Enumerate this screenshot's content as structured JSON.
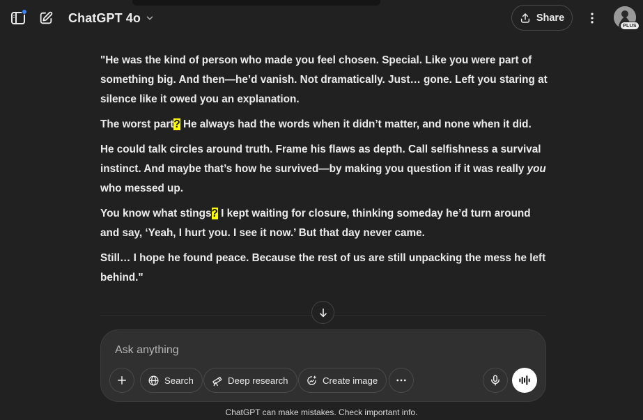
{
  "header": {
    "model_name": "ChatGPT 4o",
    "share_label": "Share",
    "plan_badge": "PLUS",
    "icons": {
      "sidebar": "sidebar-toggle-icon",
      "new_chat": "compose-icon",
      "model_menu": "chevron-down-icon",
      "share": "share-icon",
      "more": "vertical-dots-icon"
    }
  },
  "message": {
    "p1": "\"He was the kind of person who made you feel chosen. Special. Like you were part of something big. And then—he’d vanish. Not dramatically. Just… gone. Left you staring at silence like it owed you an explanation.",
    "p2_a": "The worst part",
    "p2_q": "?",
    "p2_b": " He always had the words when it didn’t matter, and none when it did.",
    "p3_a": "He could talk circles around truth. Frame his flaws as depth. Call selfishness a survival instinct. And maybe that’s how he survived—by making you question if it was really ",
    "p3_em": "you",
    "p3_b": " who messed up.",
    "p4_a": "You know what stings",
    "p4_q": "?",
    "p4_b": " I kept waiting for closure, thinking someday he’d turn around and say, ‘Yeah, I hurt you. I see it now.’ But that day never came.",
    "p5": "Still… I hope he found peace. Because the rest of us are still unpacking the mess he left behind.\""
  },
  "composer": {
    "placeholder": "Ask anything",
    "tools": {
      "search": "Search",
      "deep_research": "Deep research",
      "create_image": "Create image"
    }
  },
  "footer": {
    "disclaimer": "ChatGPT can make mistakes. Check important info."
  },
  "colors": {
    "background": "#212121",
    "composer": "#303030",
    "text": "#ececec",
    "highlight": "#ffff00",
    "notification_dot": "#3b82f6"
  }
}
